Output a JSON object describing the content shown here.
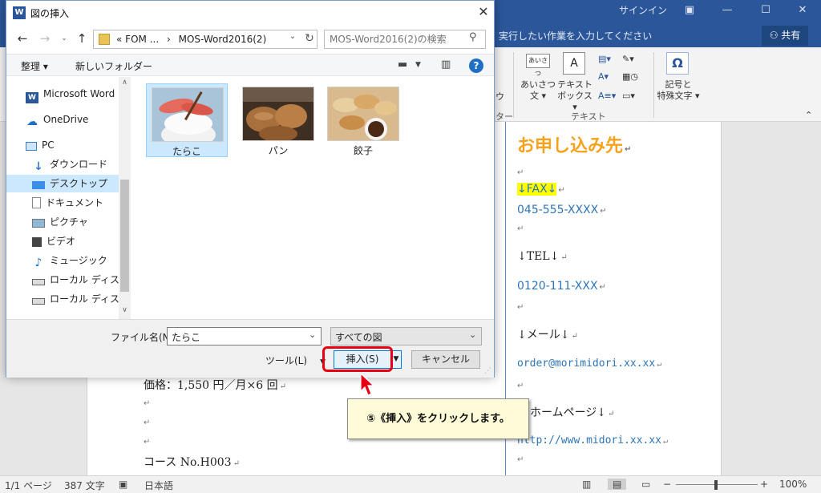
{
  "word": {
    "signin": "サインイン",
    "tell_me": "実行したい作業を入力してください",
    "share": "共有",
    "ribbon": {
      "partial_label_1": "ウ",
      "partial_label_2": "ター",
      "aisatsu_icon": "あいさつ",
      "aisatsu_line1": "あいさつ",
      "aisatsu_line2": "文 ▾",
      "textbox_line1": "テキスト",
      "textbox_line2": "ボックス ▾",
      "group_text": "テキスト",
      "symbol_glyph": "Ω",
      "symbol_line1": "記号と",
      "symbol_line2": "特殊文字 ▾"
    },
    "left_column": {
      "line_price": "価格：1,550 円／月×6 回",
      "line_course": "コース No.H003"
    },
    "right_column": {
      "title": "お申し込み先",
      "fax_label": "↓FAX↓",
      "fax_number": "045-555-XXXX",
      "tel_label": "↓TEL↓",
      "tel_number": "0120-111-XXX",
      "mail_label": "↓メール↓",
      "mail_address": "order@morimidori.xx.xx",
      "home_label": "↓ホームページ↓",
      "home_label_visible": "ホームページ↓",
      "home_url": "http://www.midori.xx.xx"
    },
    "status": {
      "page": "1/1 ページ",
      "words": "387 文字",
      "language": "日本語",
      "zoom": "100%"
    }
  },
  "dialog": {
    "title": "図の挿入",
    "address": {
      "prefix": "«",
      "crumb1": "FOM ...",
      "sep": "›",
      "crumb2": "MOS-Word2016(2)"
    },
    "search_placeholder": "MOS-Word2016(2)の検索",
    "toolbar": {
      "organize": "整理 ▾",
      "new_folder": "新しいフォルダー"
    },
    "nav_items": [
      {
        "label": "Microsoft Word",
        "icon": "word-icon"
      },
      {
        "label": "OneDrive",
        "icon": "cloud-icon"
      },
      {
        "label": "PC",
        "icon": "pc-icon"
      },
      {
        "label": "ダウンロード",
        "icon": "download-icon"
      },
      {
        "label": "デスクトップ",
        "icon": "desktop-icon"
      },
      {
        "label": "ドキュメント",
        "icon": "document-icon"
      },
      {
        "label": "ピクチャ",
        "icon": "picture-icon"
      },
      {
        "label": "ビデオ",
        "icon": "video-icon"
      },
      {
        "label": "ミュージック",
        "icon": "music-icon"
      },
      {
        "label": "ローカル ディスク (C",
        "icon": "disk-icon"
      },
      {
        "label": "ローカル ディスク (D",
        "icon": "disk-icon"
      }
    ],
    "files": [
      {
        "name": "たらこ",
        "selected": true
      },
      {
        "name": "パン",
        "selected": false
      },
      {
        "name": "餃子",
        "selected": false
      }
    ],
    "filename_label": "ファイル名(N):",
    "filename_value": "たらこ",
    "filetype_value": "すべての図",
    "tools_label": "ツール(L)",
    "insert_label": "挿入(S)",
    "cancel_label": "キャンセル"
  },
  "callout": {
    "text": "⑤《挿入》をクリックします。"
  },
  "colors": {
    "word_blue": "#2b579a",
    "title_orange": "#f5a21d",
    "link_blue": "#2e75b6",
    "highlight": "#ffff00",
    "selection": "#cce8ff",
    "annotation_red": "#e60012"
  }
}
